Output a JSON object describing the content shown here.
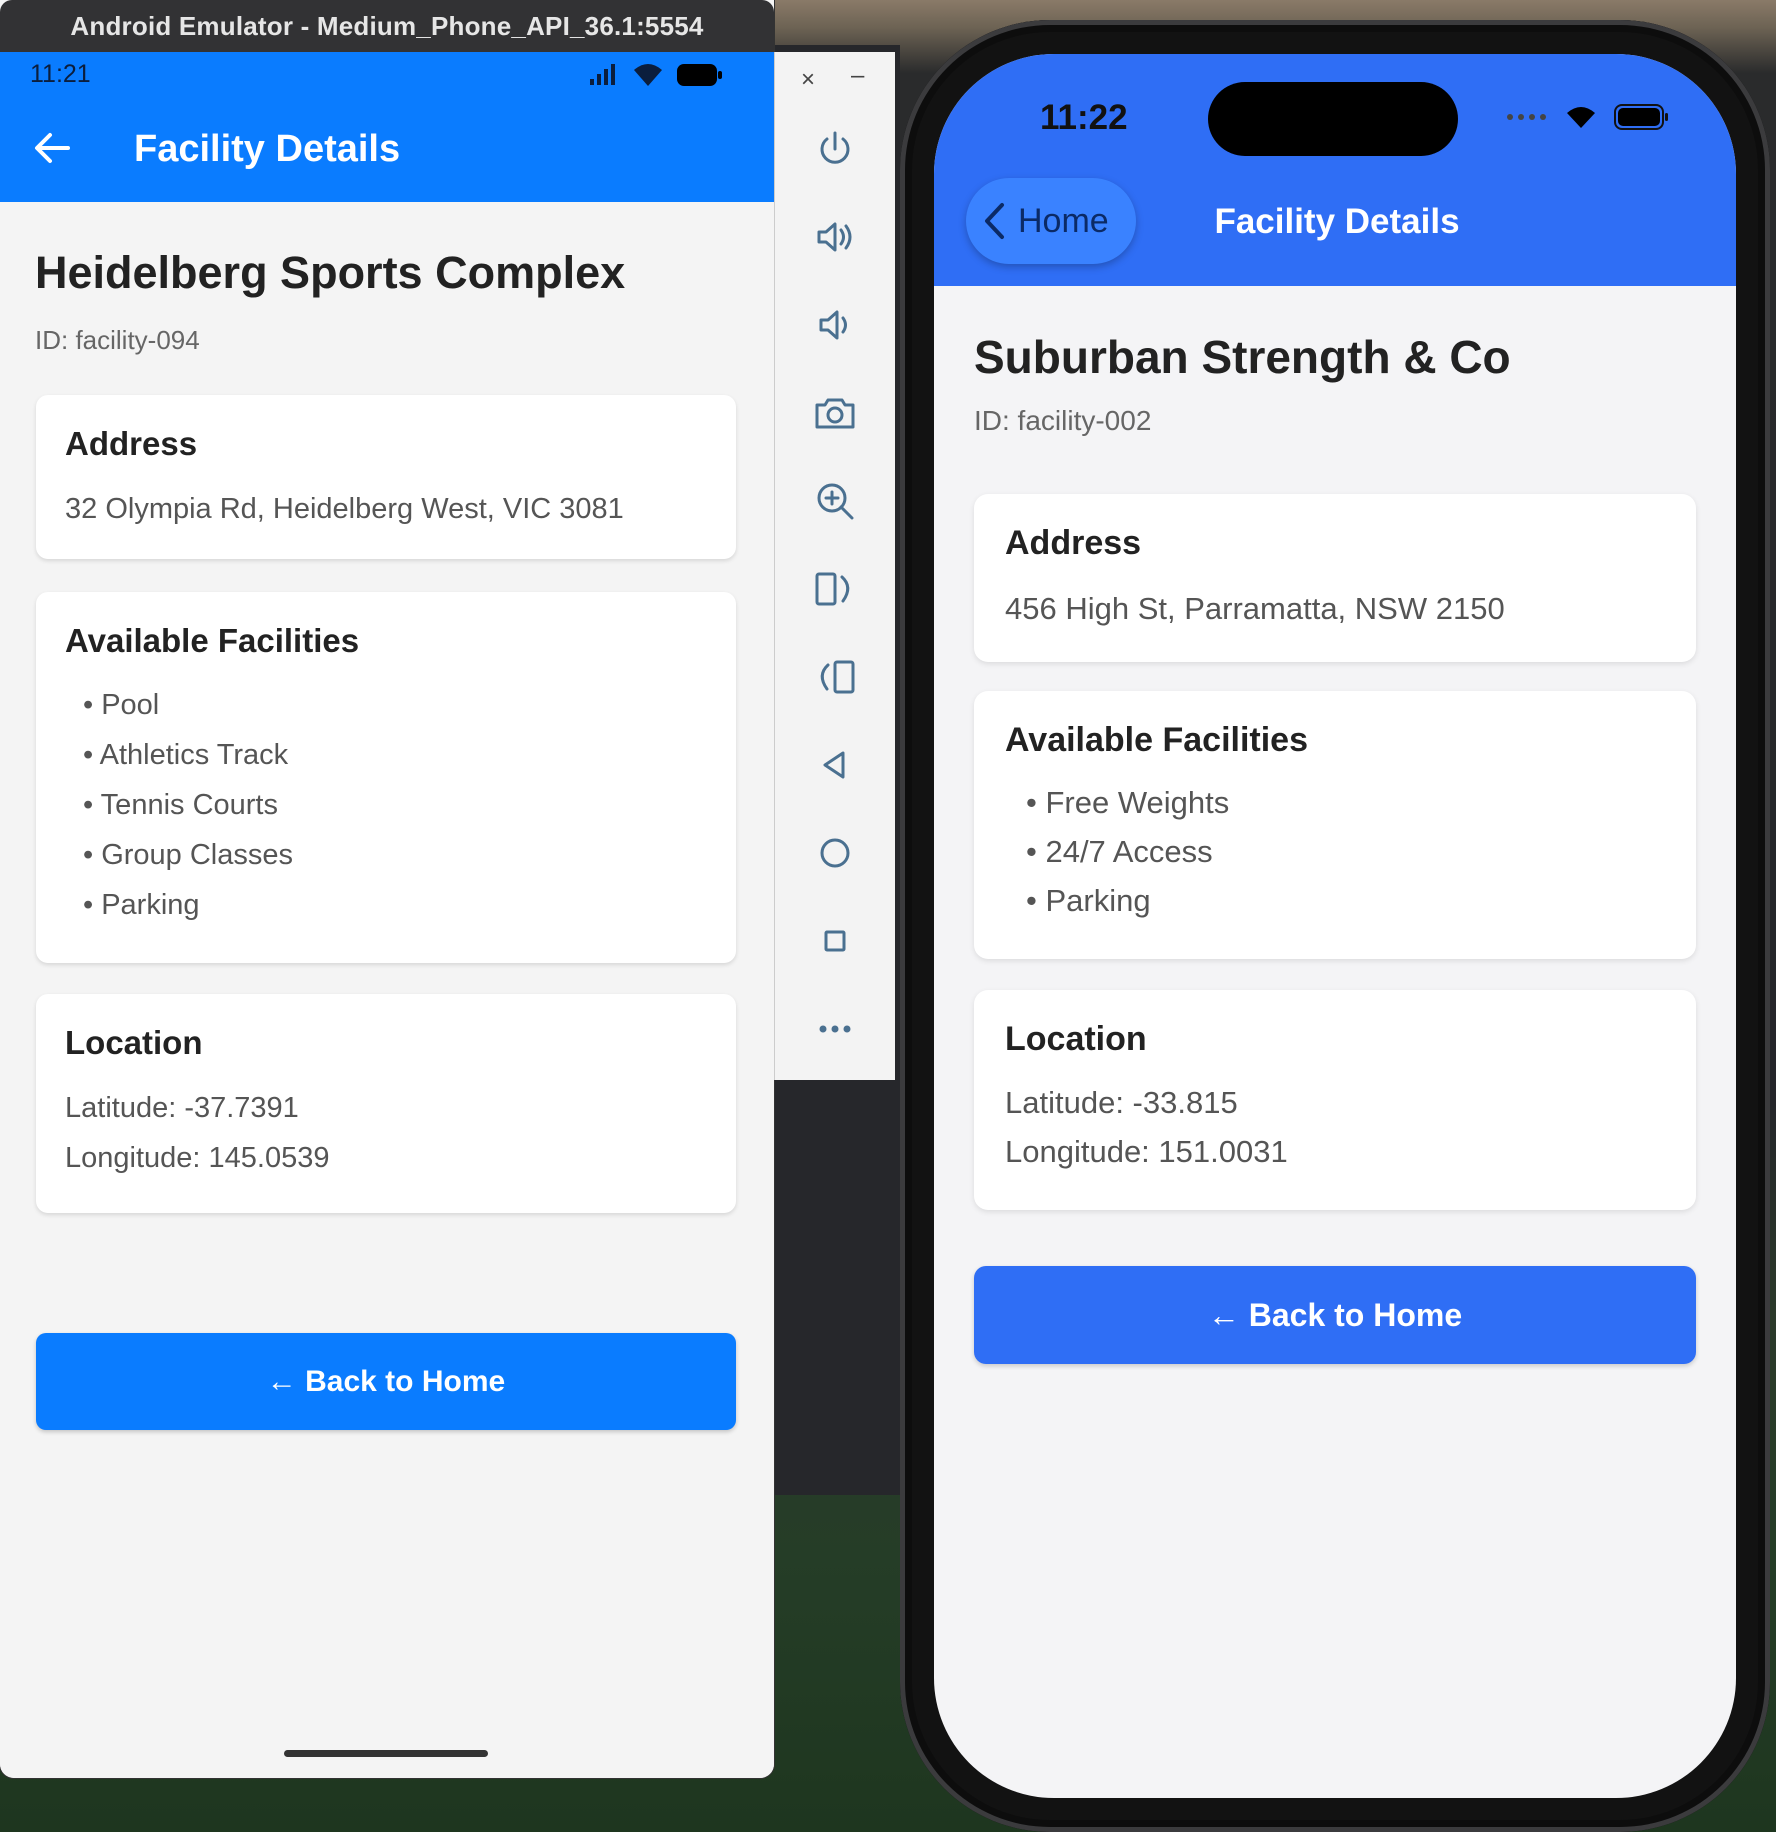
{
  "emulator": {
    "window_title": "Android Emulator - Medium_Phone_API_36.1:5554",
    "status_time": "11:21",
    "toolbar": {
      "close_label": "×",
      "minimize_label": "–"
    },
    "app_bar_title": "Facility Details",
    "facility": {
      "name": "Heidelberg Sports Complex",
      "id_text": "ID: facility-094",
      "address_heading": "Address",
      "address": "32 Olympia Rd, Heidelberg West, VIC 3081",
      "facilities_heading": "Available Facilities",
      "facilities": [
        "• Pool",
        "• Athletics Track",
        "• Tennis Courts",
        "• Group Classes",
        "• Parking"
      ],
      "location_heading": "Location",
      "latitude": "Latitude: -37.7391",
      "longitude": "Longitude: 145.0539"
    },
    "back_button_label": "← Back to Home"
  },
  "iphone": {
    "status_time": "11:22",
    "nav_back_label": "Home",
    "nav_title": "Facility Details",
    "facility": {
      "name": "Suburban Strength & Co",
      "id_text": "ID: facility-002",
      "address_heading": "Address",
      "address": "456 High St, Parramatta, NSW 2150",
      "facilities_heading": "Available Facilities",
      "facilities": [
        "• Free Weights",
        "• 24/7 Access",
        "• Parking"
      ],
      "location_heading": "Location",
      "latitude": "Latitude: -33.815",
      "longitude": "Longitude: 151.0031"
    },
    "back_button_label": "← Back to Home"
  },
  "colors": {
    "android_primary": "#0a7cff",
    "ios_primary": "#2f6ef5",
    "ios_nav_pill": "#3a82ff"
  }
}
